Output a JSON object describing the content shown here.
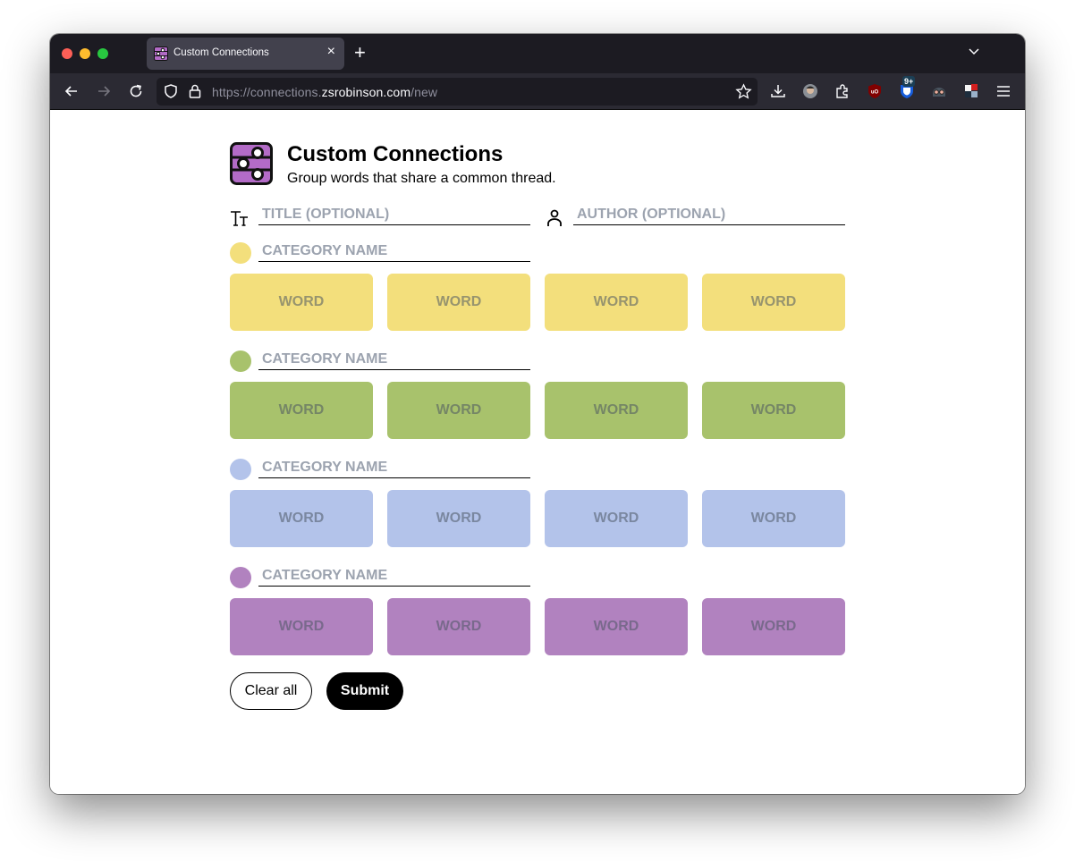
{
  "browser": {
    "tab_title": "Custom Connections",
    "url_prefix": "https://connections.",
    "url_domain": "zsrobinson.com",
    "url_path": "/new",
    "extension_badge": "9+"
  },
  "page": {
    "title": "Custom Connections",
    "subtitle": "Group words that share a common thread.",
    "title_field": {
      "placeholder": "TITLE (OPTIONAL)",
      "value": ""
    },
    "author_field": {
      "placeholder": "AUTHOR (OPTIONAL)",
      "value": ""
    },
    "groups": [
      {
        "color": "#f3df7c",
        "category_placeholder": "CATEGORY NAME",
        "word_placeholder": "WORD",
        "words": [
          "",
          "",
          "",
          ""
        ]
      },
      {
        "color": "#a8c26c",
        "category_placeholder": "CATEGORY NAME",
        "word_placeholder": "WORD",
        "words": [
          "",
          "",
          "",
          ""
        ]
      },
      {
        "color": "#b3c3ea",
        "category_placeholder": "CATEGORY NAME",
        "word_placeholder": "WORD",
        "words": [
          "",
          "",
          "",
          ""
        ]
      },
      {
        "color": "#b182bf",
        "category_placeholder": "CATEGORY NAME",
        "word_placeholder": "WORD",
        "words": [
          "",
          "",
          "",
          ""
        ]
      }
    ],
    "clear_label": "Clear all",
    "submit_label": "Submit"
  }
}
